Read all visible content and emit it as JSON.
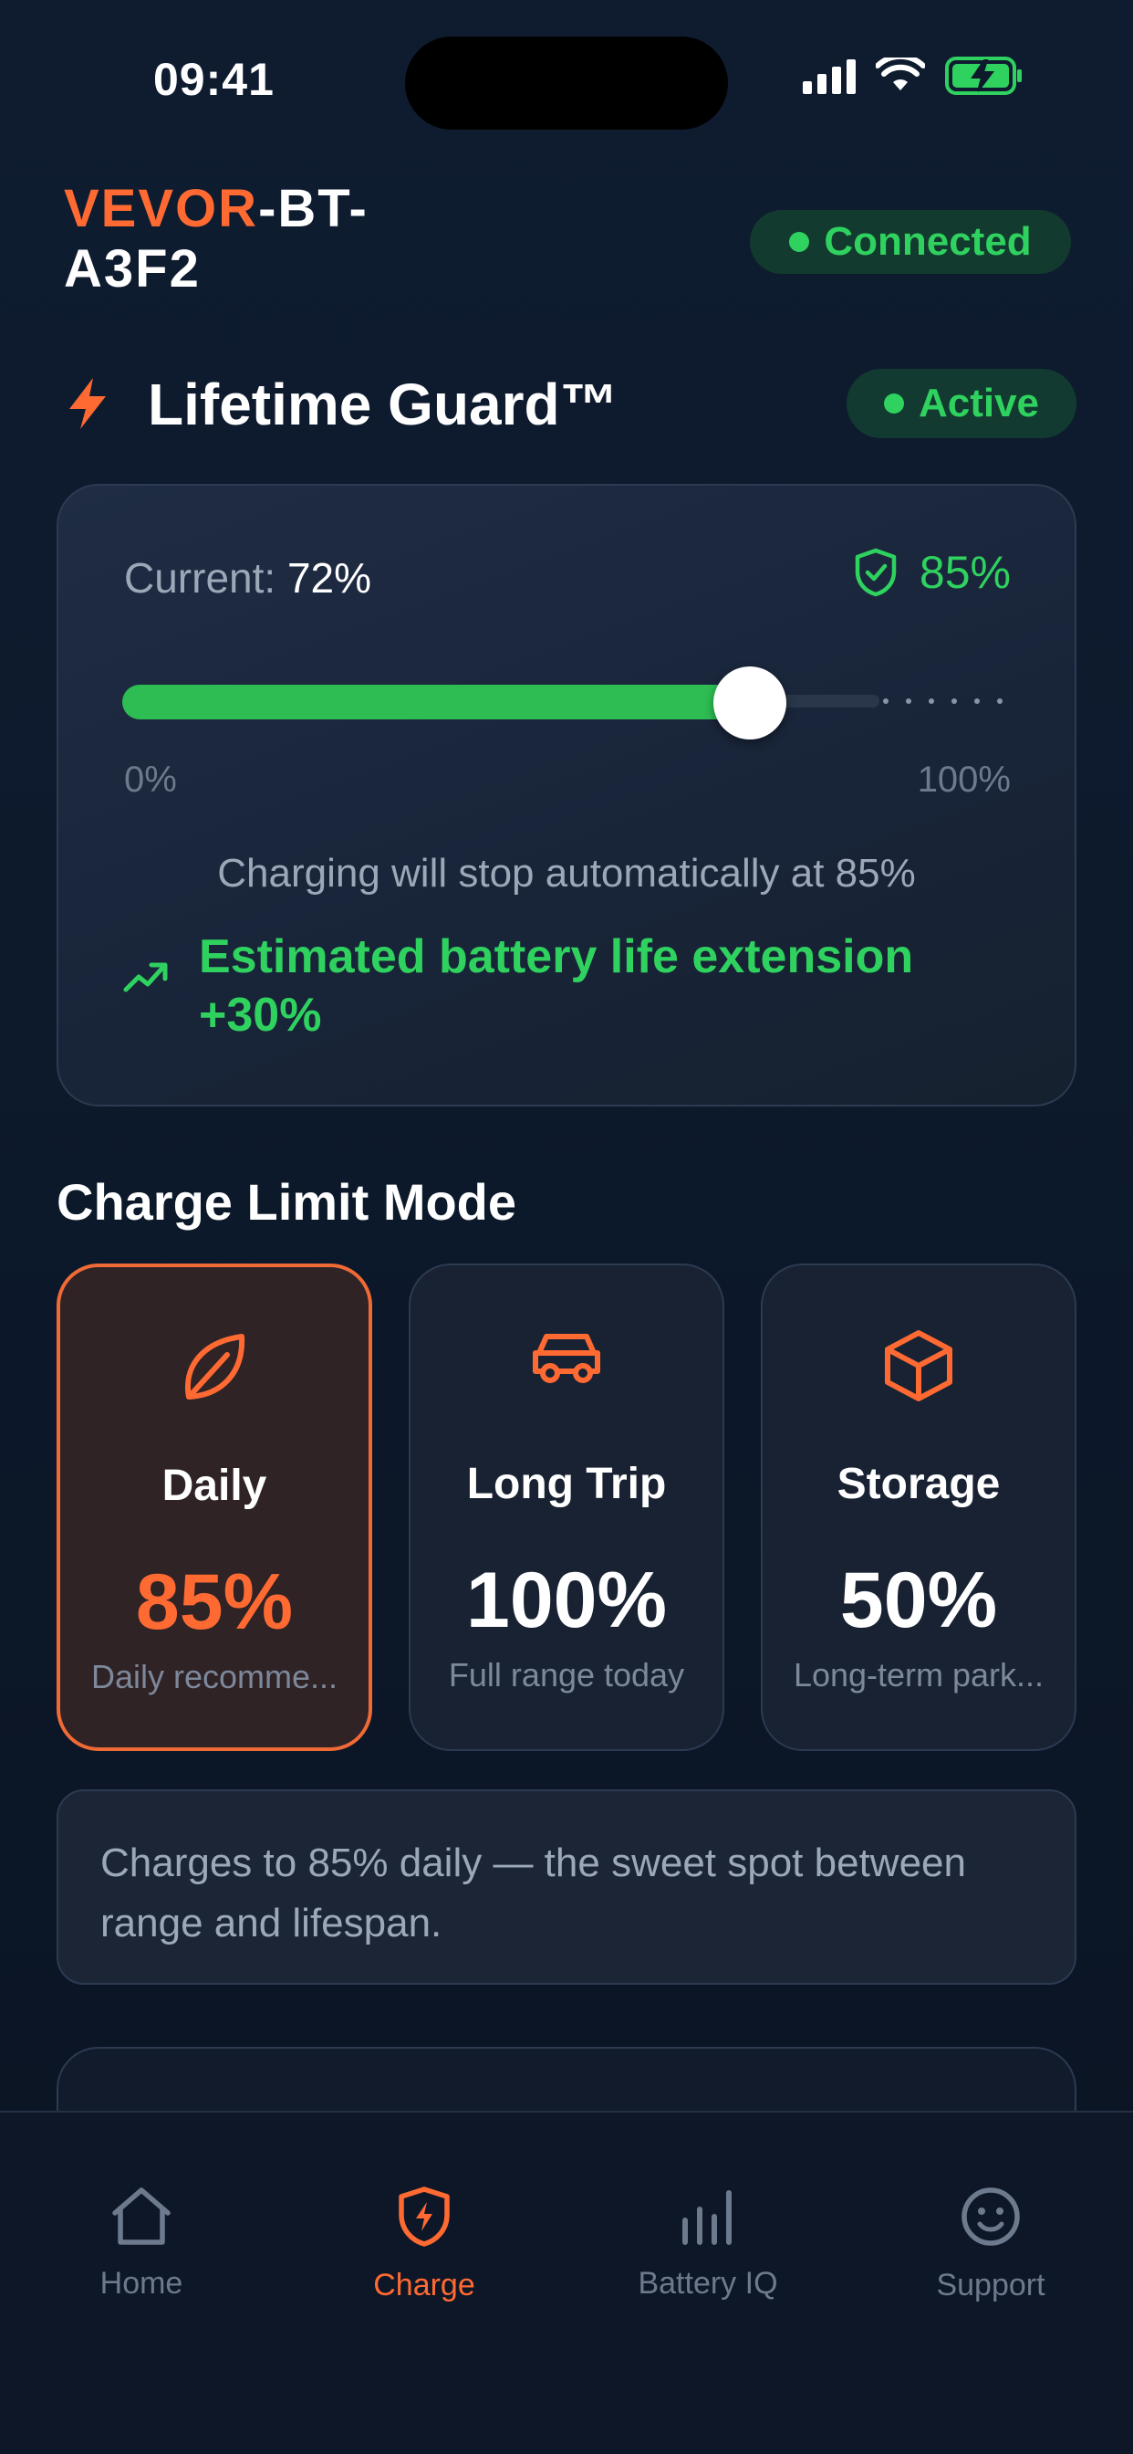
{
  "status_bar": {
    "time": "09:41"
  },
  "header": {
    "brand": "VEVOR",
    "device_suffix": "-BT-A3F2",
    "connection": "Connected"
  },
  "guard": {
    "title": "Lifetime Guard™",
    "status": "Active",
    "current_label": "Current:",
    "current_value": "72%",
    "target": "85%",
    "slider_fraction": 0.72,
    "min_label": "0%",
    "max_label": "100%",
    "stop_text": "Charging will stop automatically at 85%",
    "extension_text": "Estimated battery life extension +30%"
  },
  "modes": {
    "title": "Charge Limit Mode",
    "items": [
      {
        "name": "Daily",
        "percent": "85%",
        "subtitle": "Daily recomme...",
        "icon": "leaf-icon"
      },
      {
        "name": "Long Trip",
        "percent": "100%",
        "subtitle": "Full range today",
        "icon": "car-icon"
      },
      {
        "name": "Storage",
        "percent": "50%",
        "subtitle": "Long-term park...",
        "icon": "box-icon"
      }
    ],
    "description": "Charges to 85% daily — the sweet spot between range and lifespan."
  },
  "tabs": [
    {
      "label": "Home",
      "icon": "home-icon"
    },
    {
      "label": "Charge",
      "icon": "shield-bolt-icon"
    },
    {
      "label": "Battery IQ",
      "icon": "bar-chart-icon"
    },
    {
      "label": "Support",
      "icon": "smile-icon"
    }
  ],
  "colors": {
    "accent": "#ff6a33",
    "success": "#2fd15f",
    "background": "#0d1a2c"
  }
}
